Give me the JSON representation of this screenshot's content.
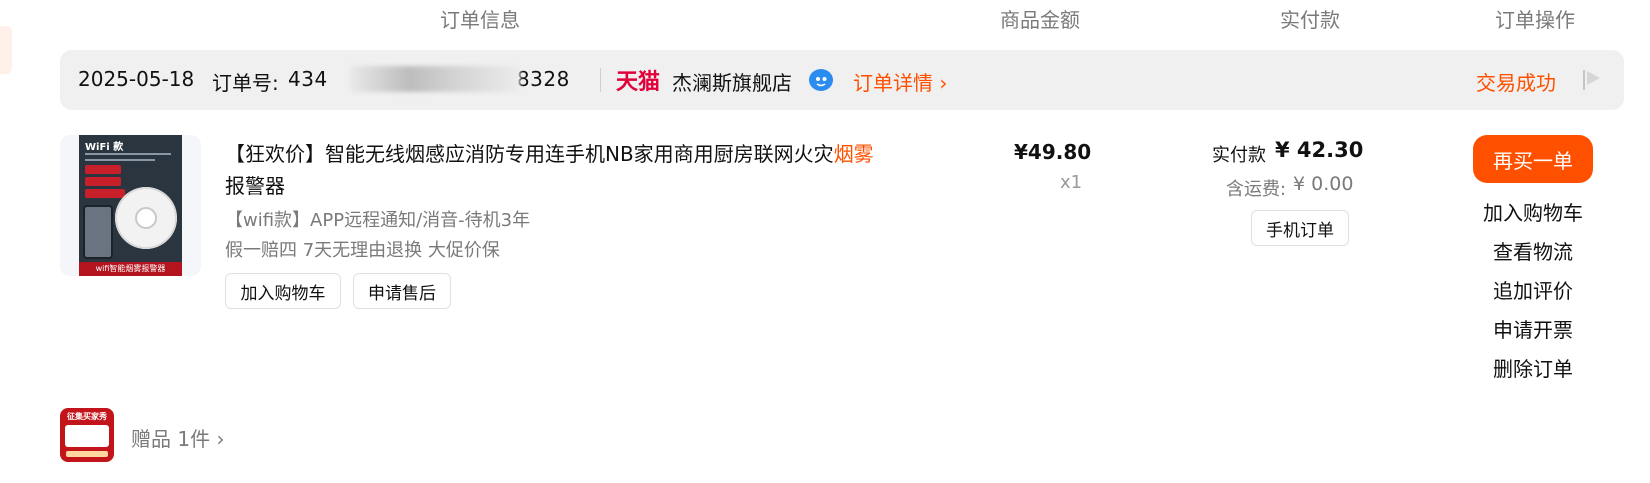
{
  "headers": {
    "order_info": "订单信息",
    "item_amount": "商品金额",
    "paid": "实付款",
    "operations": "订单操作"
  },
  "order": {
    "date": "2025-05-18",
    "number_label": "订单号:",
    "number_visible_prefix": "434",
    "number_visible_suffix": "38328",
    "platform": "天猫",
    "shop_name": "杰澜斯旗舰店",
    "detail_link": "订单详情 ›",
    "status": "交易成功"
  },
  "product": {
    "title_main": "【狂欢价】智能无线烟感应消防专用连手机NB家用商用厨房联网火灾",
    "title_highlight": "烟雾",
    "title_end": "报警器",
    "sku": "【wifi款】APP远程通知/消音-待机3年",
    "guarantee": "假一赔四 7天无理由退换 大促价保",
    "image_tag": "WiFi 款",
    "image_footer": "wifi智能烟雾报警器",
    "add_cart": "加入购物车",
    "after_sale": "申请售后",
    "price": "¥49.80",
    "quantity": "x1"
  },
  "payment": {
    "paid_label": "实付款",
    "paid_value": "¥ 42.30",
    "shipping_label": "含运费:",
    "shipping_value": "¥ 0.00",
    "mobile_order": "手机订单"
  },
  "operations": {
    "rebuy": "再买一单",
    "add_cart": "加入购物车",
    "logistics": "查看物流",
    "add_review": "追加评价",
    "invoice": "申请开票",
    "delete": "删除订单"
  },
  "gift": {
    "label": "赠品 1件 ›",
    "image_top": "征集买家秀"
  },
  "colors": {
    "accent": "#ff5000",
    "tmall": "#e0003a",
    "bar_bg": "#f0f0f0",
    "muted_text": "#7a7a7a"
  }
}
